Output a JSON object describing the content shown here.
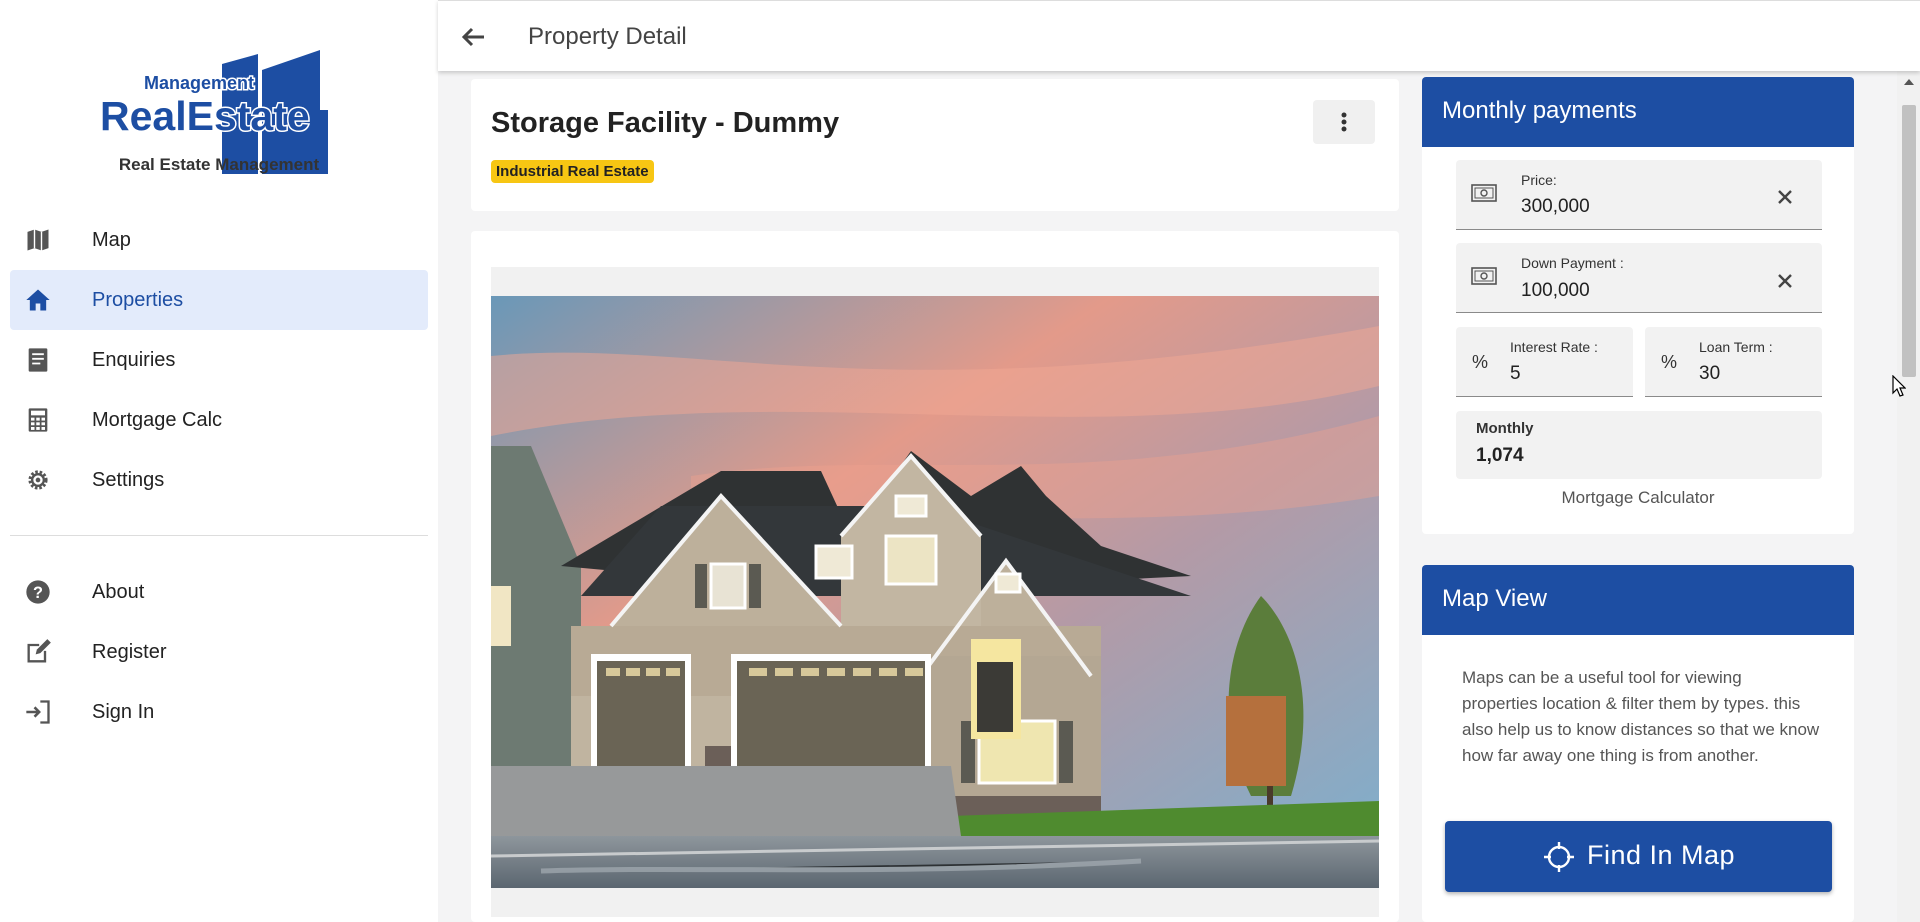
{
  "sidebar": {
    "logo": {
      "top": "Management",
      "main": "RealEstate",
      "caption": "Real Estate Management"
    },
    "items": [
      {
        "label": "Map",
        "icon": "map-icon"
      },
      {
        "label": "Properties",
        "icon": "home-icon"
      },
      {
        "label": "Enquiries",
        "icon": "document-icon"
      },
      {
        "label": "Mortgage Calc",
        "icon": "calculator-icon"
      },
      {
        "label": "Settings",
        "icon": "gear-icon"
      },
      {
        "label": "About",
        "icon": "help-icon"
      },
      {
        "label": "Register",
        "icon": "edit-icon"
      },
      {
        "label": "Sign In",
        "icon": "sign-in-icon"
      }
    ],
    "active": "Properties"
  },
  "header": {
    "title": "Property Detail",
    "back_icon": "arrow-left-icon"
  },
  "property": {
    "title": "Storage Facility - Dummy",
    "badge": "Industrial Real Estate",
    "more_icon": "more-vertical-icon"
  },
  "payments": {
    "title": "Monthly payments",
    "price_label": "Price:",
    "price_value": "300,000",
    "down_label": "Down Payment :",
    "down_value": "100,000",
    "interest_label": "Interest Rate :",
    "interest_value": "5",
    "term_label": "Loan Term :",
    "term_value": "30",
    "percent_symbol": "%",
    "monthly_label": "Monthly",
    "monthly_value": "1,074",
    "caption": "Mortgage Calculator"
  },
  "map_view": {
    "title": "Map View",
    "description": "Maps can be a useful tool for viewing properties location & filter them by types. this also help us to know distances so that we know how far away one thing is from another.",
    "button_label": "Find In Map"
  },
  "colors": {
    "primary": "#1d4ea3",
    "badge": "#f7c613",
    "active_bg": "#e3ebfb"
  }
}
